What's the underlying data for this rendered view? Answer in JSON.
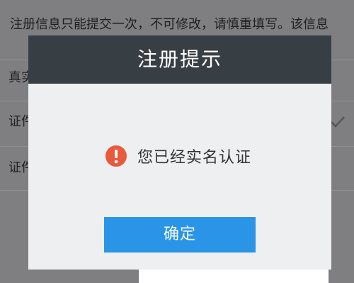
{
  "background_page": {
    "notice": "注册信息只能提交一次，不可修改，请慎重填写。该信息",
    "row_labels": [
      "真实",
      "证件",
      "证件"
    ]
  },
  "dialog": {
    "title": "注册提示",
    "message": "您已经实名认证",
    "confirm_label": "确定",
    "icon": "alert-circle-icon"
  },
  "colors": {
    "header_bg": "#383f44",
    "dialog_bg": "#eeeff1",
    "button_bg": "#2a95e6",
    "alert_icon": "#e9593c",
    "overlay": "#7f7f81"
  }
}
